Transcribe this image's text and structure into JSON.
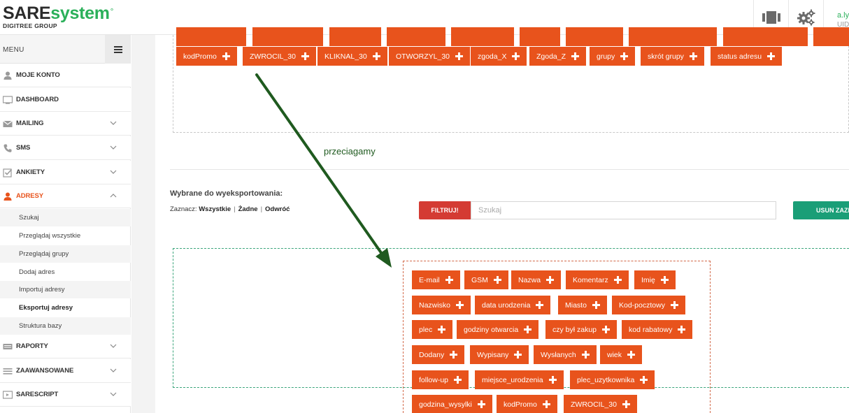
{
  "header": {
    "logo_part1": "SARE",
    "logo_part2": "system",
    "logo_degree": "°",
    "logo_sub": "DIGITREE GROUP",
    "user_name": "a.ly",
    "user_uid": "UID:"
  },
  "sidebar": {
    "menu_label": "MENU",
    "items": [
      {
        "label": "MOJE KONTO",
        "icon": "user-icon"
      },
      {
        "label": "DASHBOARD",
        "icon": "monitor-icon"
      },
      {
        "label": "MAILING",
        "icon": "envelope-icon"
      },
      {
        "label": "SMS",
        "icon": "phone-icon"
      },
      {
        "label": "ANKIETY",
        "icon": "checkbox-icon"
      },
      {
        "label": "ADRESY",
        "icon": "user-icon"
      },
      {
        "label": "RAPORTY",
        "icon": "report-icon"
      },
      {
        "label": "ZAAWANSOWANE",
        "icon": "list-icon"
      },
      {
        "label": "SARESCRIPT",
        "icon": "script-icon"
      }
    ],
    "subitems": [
      "Szukaj",
      "Przeglądaj wszystkie",
      "Przeglądaj grupy",
      "Dodaj adres",
      "Importuj adresy",
      "Eksportuj adresy",
      "Struktura bazy"
    ]
  },
  "available_fields": [
    "kodPromo",
    "ZWROCIL_30",
    "KLIKNAL_30",
    "OTWORZYL_30",
    "zgoda_X",
    "Zgoda_Z",
    "grupy",
    "skrót grupy",
    "status adresu"
  ],
  "annotation": "przeciagamy",
  "export": {
    "title": "Wybrane do wyeksportowania:",
    "select_label": "Zaznacz:",
    "select_all": "Wszystkie",
    "select_none": "Żadne",
    "select_invert": "Odwróć",
    "filter_button": "FILTRUJ!",
    "search_placeholder": "Szukaj",
    "remove_button": "USUN ZAZN"
  },
  "selected_fields": [
    [
      "E-mail",
      "GSM",
      "Nazwa",
      "Komentarz",
      "Imię"
    ],
    [
      "Nazwisko",
      "data urodzenia",
      "Miasto",
      "Kod-pocztowy"
    ],
    [
      "plec",
      "godziny otwarcia",
      "czy był zakup",
      "kod rabatowy"
    ],
    [
      "Dodany",
      "Wypisany",
      "Wysłanych",
      "wiek"
    ],
    [
      "follow-up",
      "miejsce_urodzenia",
      "plec_uzytkownika"
    ],
    [
      "godzina_wysylki",
      "kodPromo",
      "ZWROCIL_30"
    ]
  ],
  "colors": {
    "accent": "#e8531c",
    "brand_green": "#2bb05a",
    "filter_red": "#d43b33",
    "remove_green": "#1a9e77",
    "arrow": "#1f5a1f"
  }
}
